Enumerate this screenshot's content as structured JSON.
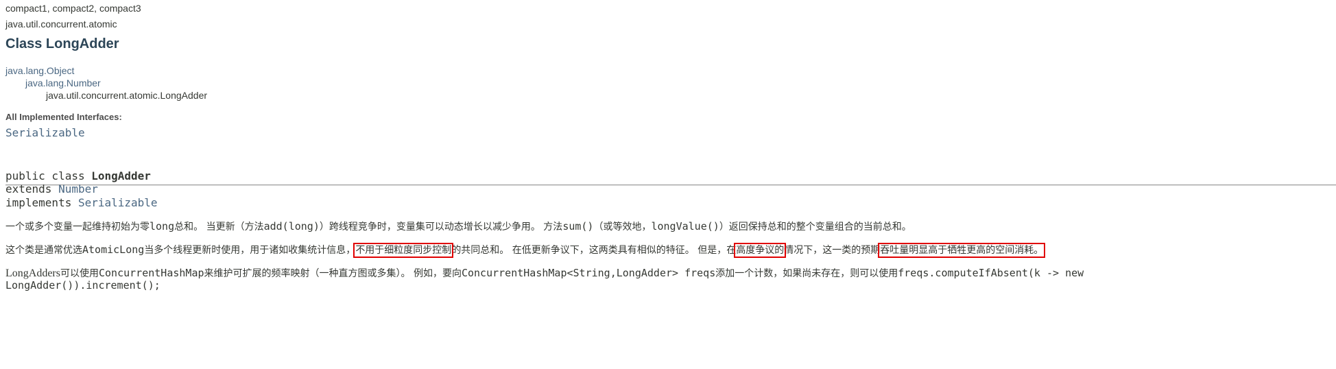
{
  "header": {
    "profiles": "compact1, compact2, compact3",
    "package": "java.util.concurrent.atomic",
    "title": "Class LongAdder"
  },
  "hierarchy": {
    "level1": "java.lang.Object",
    "level2": "java.lang.Number",
    "level3": "java.util.concurrent.atomic.LongAdder"
  },
  "interfaces": {
    "label": "All Implemented Interfaces:",
    "value": "Serializable"
  },
  "signature": {
    "decl_prefix": "public class ",
    "class_name": "LongAdder",
    "extends_kw": "extends ",
    "extends_link": "Number",
    "implements_kw": "implements ",
    "implements_link": "Serializable"
  },
  "description": {
    "p1": {
      "a": "一个或多个变量一起维持初始为零",
      "code1": "long",
      "b": "总和。 当更新（方法",
      "code2": "add(long)",
      "c": "）跨线程竞争时，变量集可以动态增长以减少争用。 方法",
      "code3": "sum()",
      "d": "（或等效地，",
      "code4": "longValue()",
      "e": "）返回保持总和的整个变量组合的当前总和。"
    },
    "p2": {
      "a": "这个类是通常优选",
      "code1": "AtomicLong",
      "b": "当多个线程更新时使用，用于诸如收集统计信息，",
      "hl1": "不用于细粒度同步控制",
      "c": "的共同总和。 在低更新争议下，这两类具有相似的特征。 但是，在",
      "hl2": "高度争议的",
      "d": "情况下，这一类的预期",
      "hl3": "吞吐量明显高于牺牲更高的空间消耗。"
    },
    "p3": {
      "a": "LongAdders",
      "b": "可以使用",
      "code1": "ConcurrentHashMap",
      "c": "来维护可扩展的频率映射（一种直方图或多集）。 例如，要向",
      "code2": "ConcurrentHashMap<String,LongAdder> freqs",
      "d": "添加一个计数，如果尚未存在，则可以使用",
      "code3": "freqs.computeIfAbsent(k -> new",
      "code4": "LongAdder()).increment();"
    }
  }
}
